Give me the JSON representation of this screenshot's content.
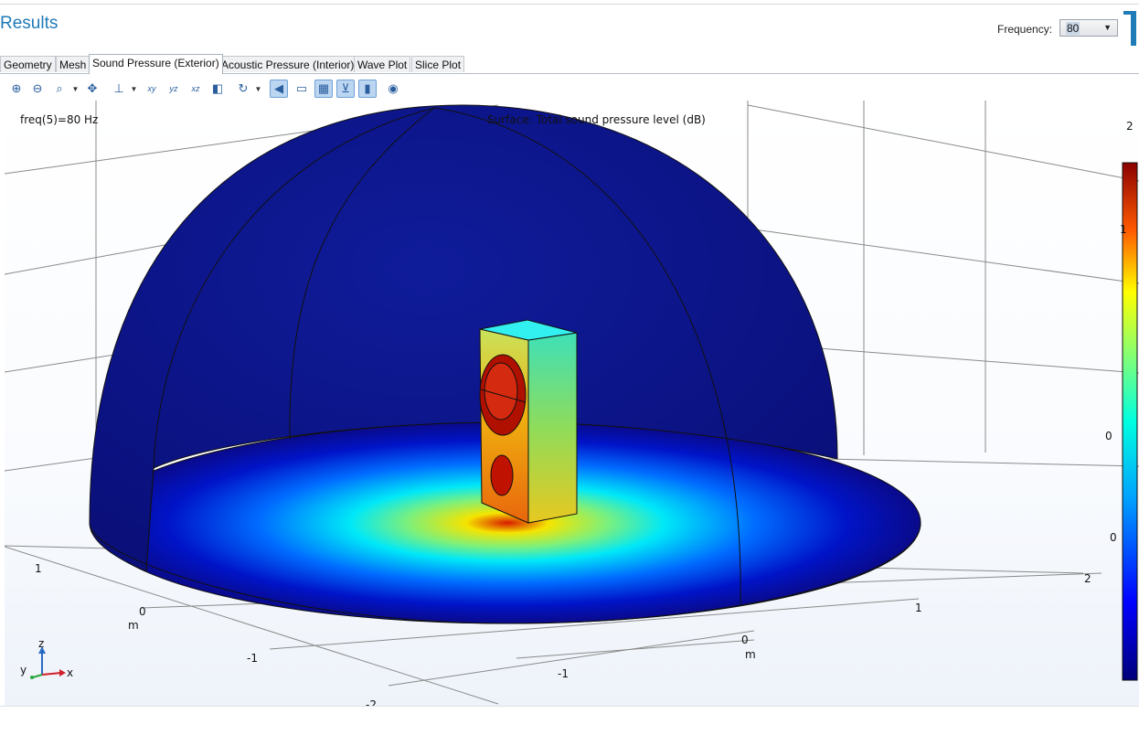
{
  "header": {
    "title": "Results",
    "frequency_label": "Frequency:",
    "frequency_value": "80"
  },
  "tabs": [
    {
      "label": "Geometry",
      "active": false
    },
    {
      "label": "Mesh",
      "active": false
    },
    {
      "label": "Sound Pressure (Exterior)",
      "active": true
    },
    {
      "label": "Acoustic Pressure (Interior)",
      "active": false
    },
    {
      "label": "Wave Plot",
      "active": false
    },
    {
      "label": "Slice Plot",
      "active": false
    }
  ],
  "toolbar": {
    "icons": [
      "zoom-in-icon",
      "zoom-out-icon",
      "zoom-box-icon",
      "zoom-extents-icon",
      "view-axis-icon",
      "view-xy-icon",
      "view-yz-icon",
      "view-xz-icon",
      "scene-light-icon",
      "reset-rotation-icon",
      "transparency-icon",
      "wireframe-icon",
      "grid-icon",
      "axis-orientation-icon",
      "color-legend-icon",
      "snapshot-icon"
    ],
    "xy_label": "xy",
    "yz_label": "yz",
    "xz_label": "xz"
  },
  "plot": {
    "freq_text": "freq(5)=80 Hz",
    "title": "Surface: Total sound pressure level (dB)",
    "axis_labels": {
      "x": "x",
      "y": "y",
      "z": "z",
      "unit": "m"
    },
    "tick_labels": {
      "left_axis": [
        "1",
        "0",
        "-1",
        "-2"
      ],
      "right_axis": [
        "2",
        "1",
        "0",
        "-1"
      ],
      "vertical": [
        "2",
        "1",
        "0",
        "0"
      ]
    },
    "colormap": "rainbow",
    "colors": {
      "low": "#00008f",
      "high": "#8b0000",
      "accent": "#1f7ab8"
    }
  }
}
